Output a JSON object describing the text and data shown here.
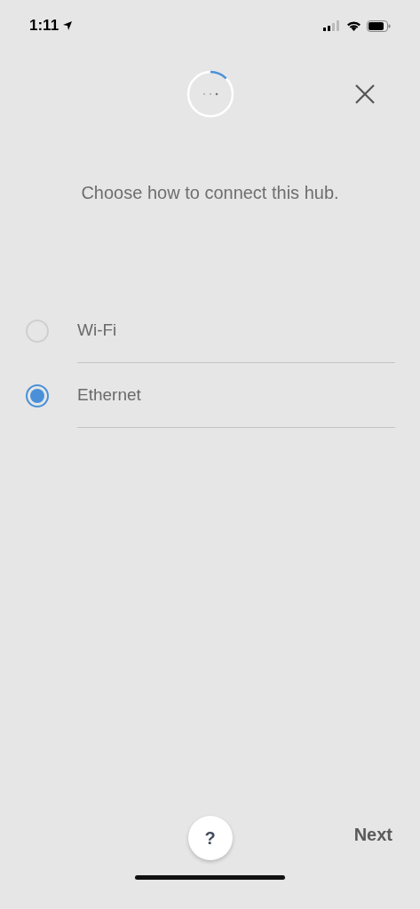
{
  "status_bar": {
    "time": "1:11"
  },
  "prompt": "Choose how to connect this hub.",
  "options": [
    {
      "label": "Wi-Fi",
      "selected": false
    },
    {
      "label": "Ethernet",
      "selected": true
    }
  ],
  "footer": {
    "help": "?",
    "next": "Next"
  }
}
